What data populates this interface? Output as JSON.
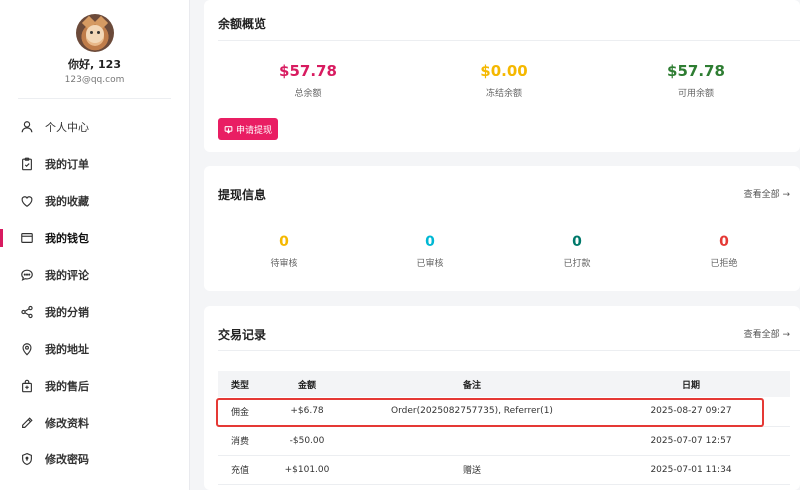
{
  "profile": {
    "greeting": "你好, 123",
    "email": "123@qq.com"
  },
  "sidebar": {
    "items": [
      {
        "label": "个人中心",
        "icon": "user-icon"
      },
      {
        "label": "我的订单",
        "icon": "clipboard-icon"
      },
      {
        "label": "我的收藏",
        "icon": "heart-icon"
      },
      {
        "label": "我的钱包",
        "icon": "wallet-icon",
        "active": true
      },
      {
        "label": "我的评论",
        "icon": "comment-icon"
      },
      {
        "label": "我的分销",
        "icon": "share-icon"
      },
      {
        "label": "我的地址",
        "icon": "location-pin-icon"
      },
      {
        "label": "我的售后",
        "icon": "service-bag-icon"
      },
      {
        "label": "修改资料",
        "icon": "pencil-icon"
      },
      {
        "label": "修改密码",
        "icon": "shield-icon"
      }
    ]
  },
  "balance": {
    "title": "余额概览",
    "total_amount": "$57.78",
    "total_label": "总余额",
    "frozen_amount": "$0.00",
    "frozen_label": "冻结余额",
    "available_amount": "$57.78",
    "available_label": "可用余额",
    "withdraw_button": "申请提现"
  },
  "withdraw_info": {
    "title": "提现信息",
    "view_all": "查看全部 →",
    "pending_count": "0",
    "pending_label": "待审核",
    "approved_count": "0",
    "approved_label": "已审核",
    "paid_count": "0",
    "paid_label": "已打款",
    "rejected_count": "0",
    "rejected_label": "已拒绝"
  },
  "transactions": {
    "title": "交易记录",
    "view_all": "查看全部 →",
    "columns": {
      "type": "类型",
      "amount": "金额",
      "note": "备注",
      "date": "日期"
    },
    "rows": [
      {
        "type": "佣金",
        "amount": "+$6.78",
        "note": "Order(2025082757735), Referrer(1)",
        "date": "2025-08-27 09:27"
      },
      {
        "type": "消费",
        "amount": "-$50.00",
        "note": "",
        "date": "2025-07-07 12:57"
      },
      {
        "type": "充值",
        "amount": "+$101.00",
        "note": "赠送",
        "date": "2025-07-01 11:34"
      }
    ]
  },
  "colors": {
    "accent": "#e91e63",
    "total": "#d81b60",
    "frozen": "#f5b800",
    "available": "#2e7d32",
    "approved": "#00b8d4",
    "paid": "#00796b",
    "rejected": "#e53935"
  }
}
